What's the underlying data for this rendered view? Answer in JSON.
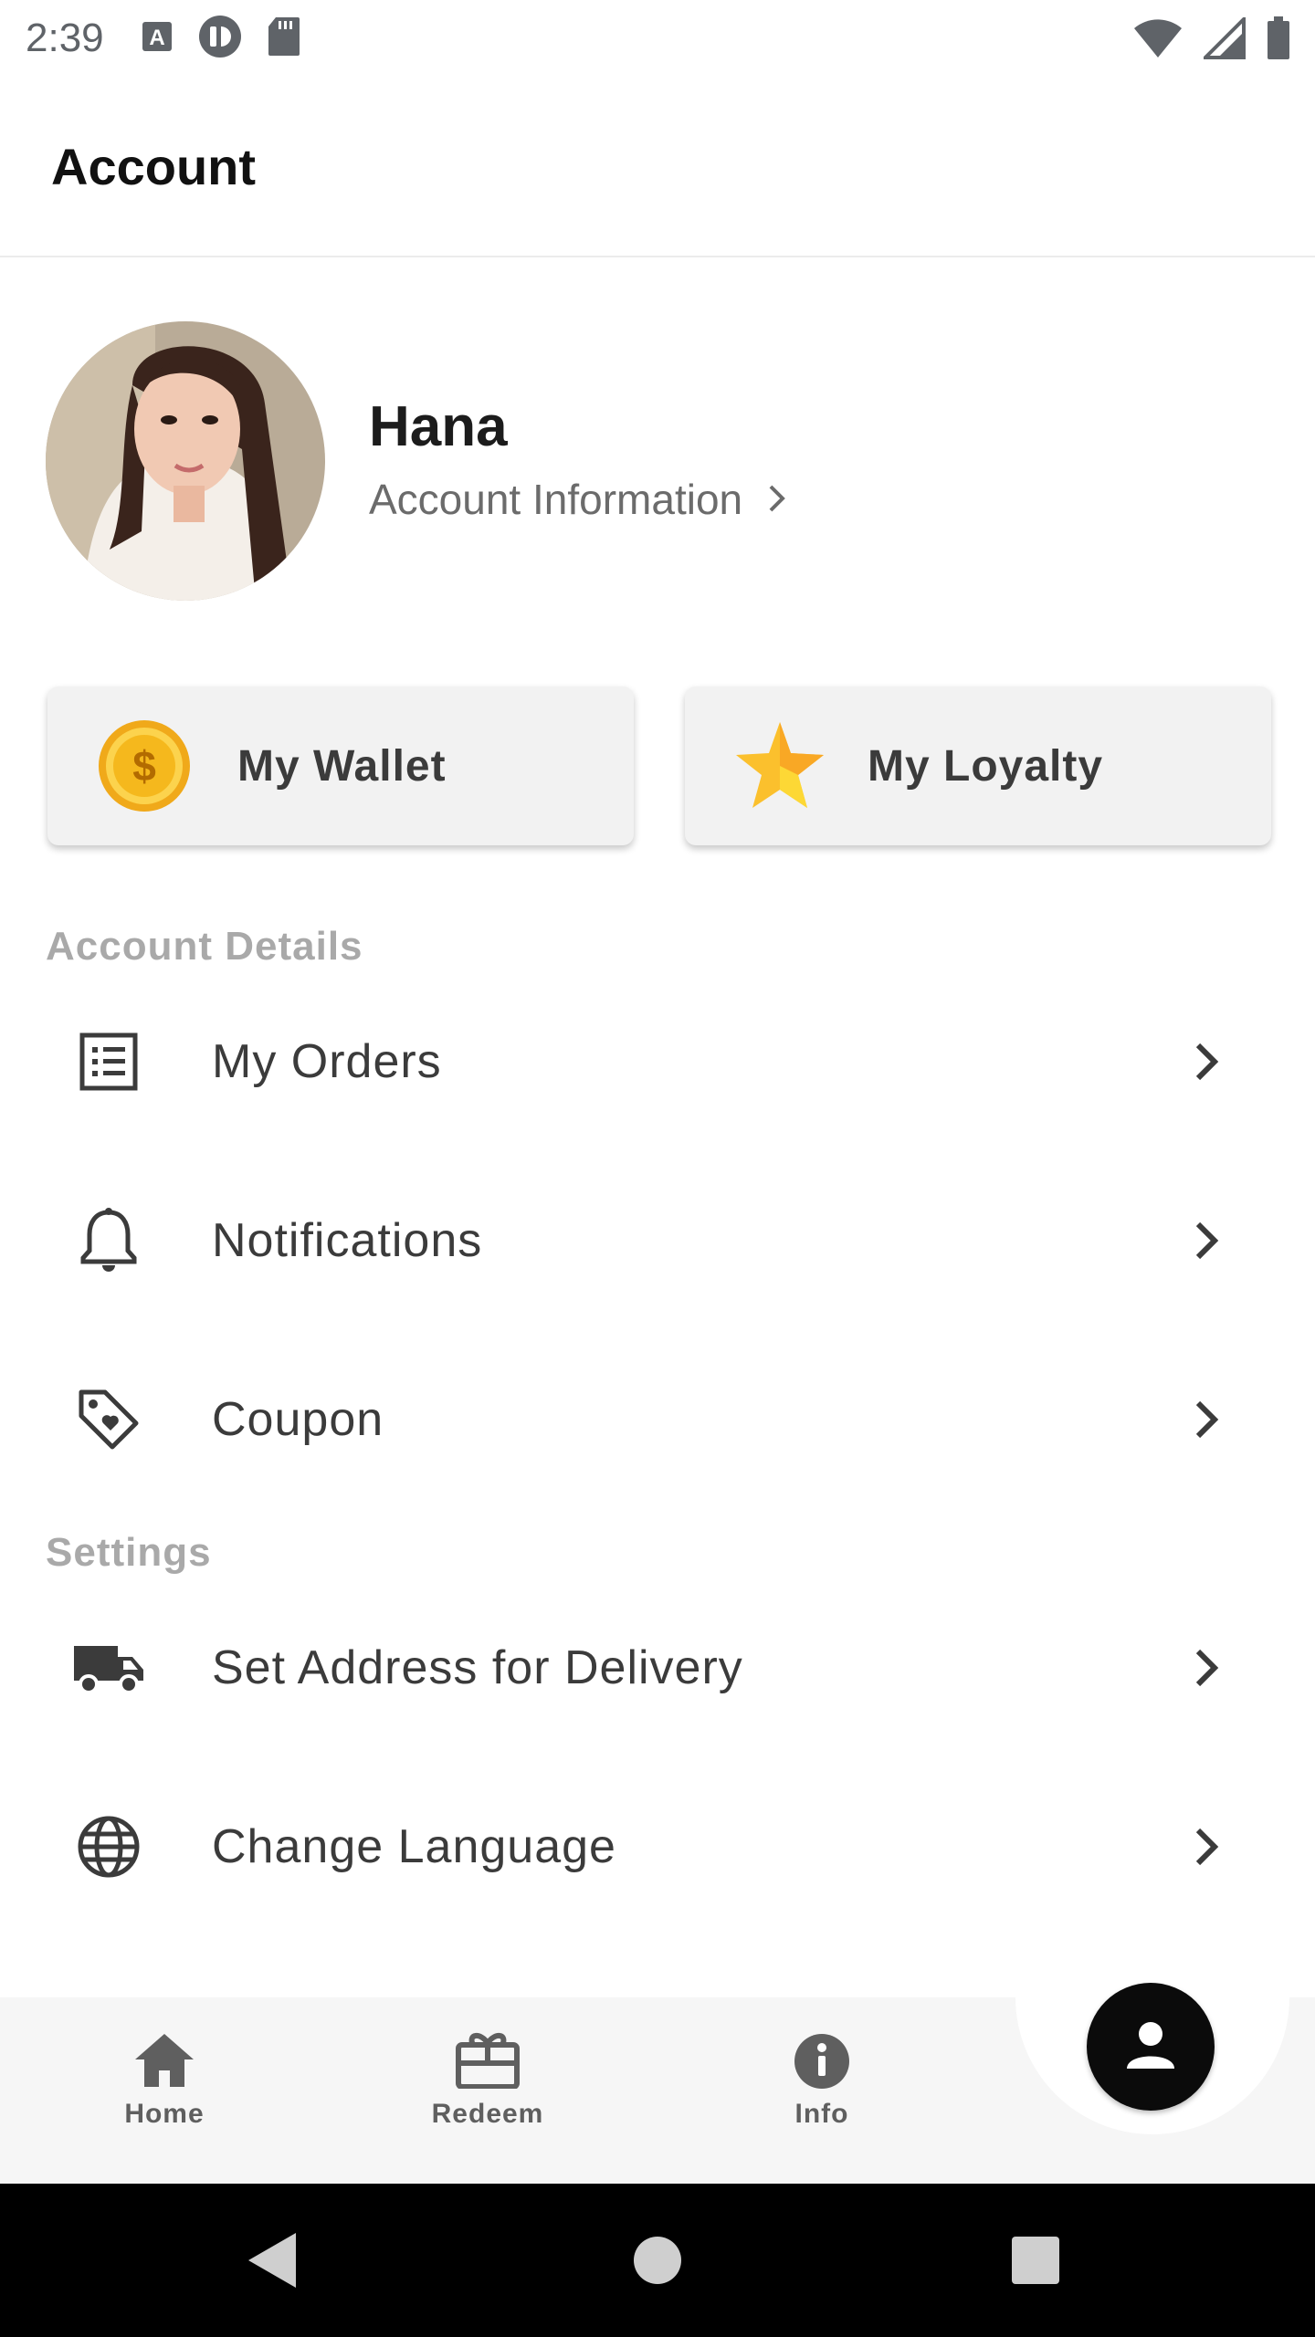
{
  "status_bar": {
    "time": "2:39",
    "left_icons": [
      "keyboard-a-icon",
      "clock-badge-icon",
      "sd-card-icon"
    ],
    "right_icons": [
      "wifi-icon",
      "signal-icon",
      "battery-icon"
    ]
  },
  "header": {
    "title": "Account"
  },
  "profile": {
    "name": "Hana",
    "account_link": "Account Information"
  },
  "cards": {
    "wallet": {
      "label": "My Wallet",
      "icon": "gold-coin-icon"
    },
    "loyalty": {
      "label": "My Loyalty",
      "icon": "gold-star-icon"
    }
  },
  "sections": {
    "account_details": "Account Details",
    "settings": "Settings"
  },
  "menu": {
    "my_orders": "My Orders",
    "notifications": "Notifications",
    "coupon": "Coupon",
    "address": "Set Address for Delivery",
    "language": "Change Language"
  },
  "bottom_nav": {
    "home": "Home",
    "redeem": "Redeem",
    "info": "Info",
    "active": "account"
  },
  "colors": {
    "accent": "#0b0b0b",
    "coin": "#f5b81d",
    "star": "#fbc02d",
    "section_header": "#a9a9a9"
  }
}
